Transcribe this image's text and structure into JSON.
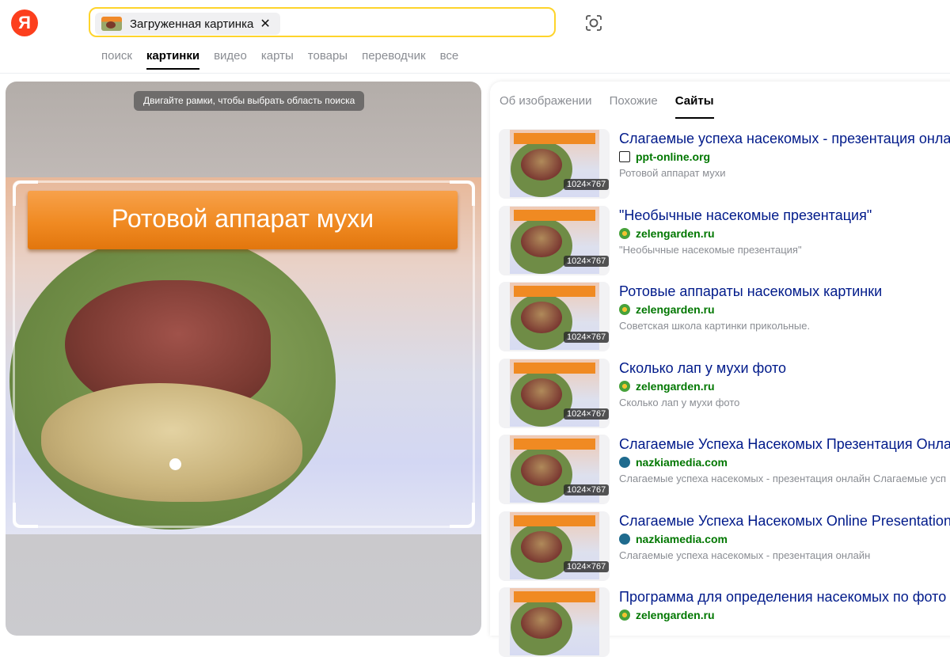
{
  "brand": {
    "logo_letter": "Я",
    "logo_color": "#fc3f1d"
  },
  "search": {
    "chip_label": "Загруженная картинка",
    "chip_close": "✕",
    "camera_icon": "camera-lens-icon",
    "border_color": "#fed42b"
  },
  "nav": {
    "items": [
      "поиск",
      "картинки",
      "видео",
      "карты",
      "товары",
      "переводчик",
      "все"
    ],
    "active": "картинки"
  },
  "preview": {
    "hint": "Двигайте рамки, чтобы выбрать область поиска",
    "slide_title": "Ротовой аппарат мухи"
  },
  "tabs": {
    "items": [
      "Об изображении",
      "Похожие",
      "Сайты"
    ],
    "active": "Сайты"
  },
  "results": [
    {
      "title": "Слагаемые успеха насекомых - презентация онлайн",
      "site": "ppt-online.org",
      "favicon": "ppt-icon",
      "desc": "Ротовой аппарат мухи",
      "size": "1024×767"
    },
    {
      "title": "\"Необычные насекомые презентация\"",
      "site": "zelengarden.ru",
      "favicon": "zelengarden-icon",
      "desc": "\"Необычные насекомые презентация\"",
      "size": "1024×767"
    },
    {
      "title": "Ротовые аппараты насекомых картинки",
      "site": "zelengarden.ru",
      "favicon": "zelengarden-icon",
      "desc": "Советская школа картинки прикольные.",
      "size": "1024×767"
    },
    {
      "title": "Сколько лап у мухи фото",
      "site": "zelengarden.ru",
      "favicon": "zelengarden-icon",
      "desc": "Сколько лап у мухи фото",
      "size": "1024×767"
    },
    {
      "title": "Слагаемые Успеха Насекомых Презентация Онлайн",
      "site": "nazkiamedia.com",
      "favicon": "wordpress-icon",
      "desc": "Слагаемые успеха насекомых - презентация онлайн Слагаемые усп",
      "size": "1024×767"
    },
    {
      "title": "Слагаемые Успеха Насекомых Online Presentation - N",
      "site": "nazkiamedia.com",
      "favicon": "wordpress-icon",
      "desc": "Слагаемые успеха насекомых - презентация онлайн",
      "size": "1024×767"
    },
    {
      "title": "Программа для определения насекомых по фото",
      "site": "zelengarden.ru",
      "favicon": "zelengarden-icon",
      "desc": "",
      "size": ""
    }
  ]
}
